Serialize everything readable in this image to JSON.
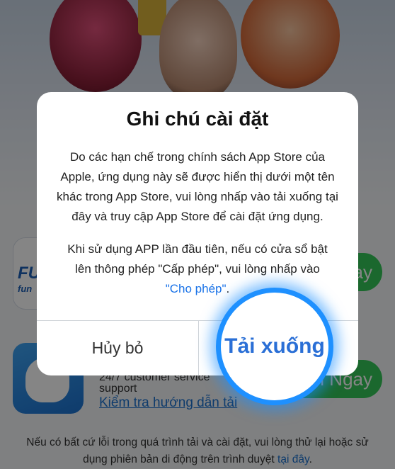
{
  "background": {
    "app1": {
      "icon_text": "FU",
      "icon_subtext": "fun",
      "button_label": "Ngay"
    },
    "app2": {
      "support_line1": "24/7 customer service",
      "support_line2": "support",
      "guide_link": "Kiểm tra hướng dẫn tải",
      "button_label": "i Ngay"
    },
    "footer_text": "Nếu có bất cứ lỗi trong quá trình tải và cài đặt, vui lòng thử lại hoặc sử dụng phiên bản di động trên trình duyệt ",
    "footer_link": "tại đây",
    "footer_end": "."
  },
  "dialog": {
    "title": "Ghi chú cài đặt",
    "message": "Do các hạn chế trong chính sách App Store của Apple, ứng dụng này sẽ được hiển thị dưới một tên khác trong App Store, vui lòng nhấp vào tải xuống tại đây và truy cập App Store để cài đặt ứng dụng.",
    "note_prefix": "Khi sử dụng APP lần đầu tiên, nếu có cửa sổ bật lên thông phép \"Cấp phép\", vui lòng nhấp vào ",
    "note_link": "\"Cho phép\"",
    "note_suffix": ".",
    "cancel_label": "Hủy bỏ",
    "confirm_label": "Tải xuống"
  },
  "colors": {
    "accent_blue": "#1e90ff",
    "download_green": "#34c759",
    "link_blue": "#1a73e8"
  }
}
